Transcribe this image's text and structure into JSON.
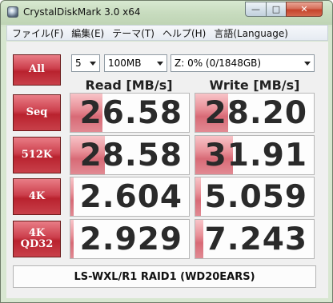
{
  "window": {
    "title": "CrystalDiskMark 3.0 x64",
    "buttons": {
      "minimize": "—",
      "maximize": "□",
      "close": "✕"
    }
  },
  "menu": [
    "ファイル(F)",
    "編集(E)",
    "テーマ(T)",
    "ヘルプ(H)",
    "言語(Language)"
  ],
  "controls": {
    "all_button": "All",
    "count": "5",
    "size": "100MB",
    "drive": "Z: 0% (0/1848GB)"
  },
  "headers": {
    "read": "Read [MB/s]",
    "write": "Write [MB/s]"
  },
  "rows": [
    {
      "label": "Seq",
      "label2": "",
      "read": "26.58",
      "write": "28.20",
      "read_fill": 0.27,
      "write_fill": 0.28
    },
    {
      "label": "512K",
      "label2": "",
      "read": "28.58",
      "write": "31.91",
      "read_fill": 0.29,
      "write_fill": 0.32
    },
    {
      "label": "4K",
      "label2": "",
      "read": "2.604",
      "write": "5.059",
      "read_fill": 0.03,
      "write_fill": 0.05
    },
    {
      "label": "4K",
      "label2": "QD32",
      "read": "2.929",
      "write": "7.243",
      "read_fill": 0.03,
      "write_fill": 0.07
    }
  ],
  "comment": "LS-WXL/R1 RAID1 (WD20EARS)"
}
